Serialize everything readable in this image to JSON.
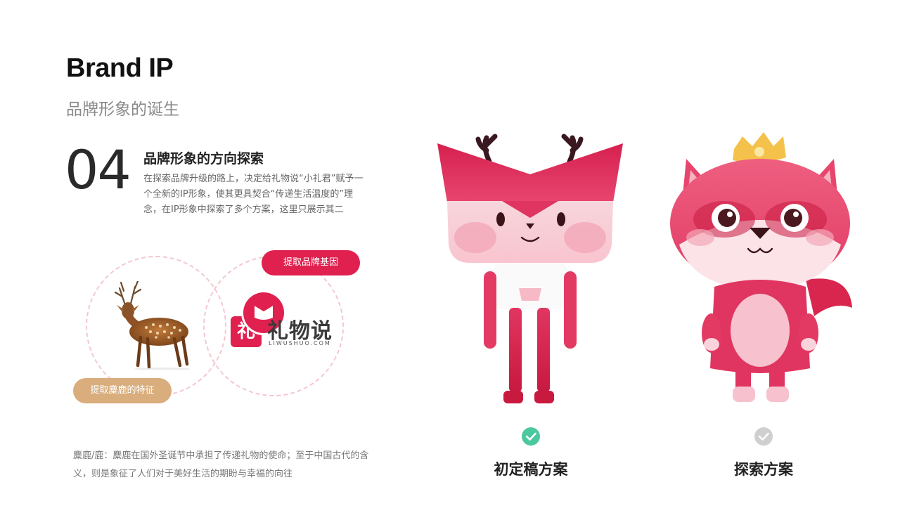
{
  "header": {
    "title": "Brand IP",
    "subtitle": "品牌形象的诞生"
  },
  "section": {
    "number": "04",
    "title": "品牌形象的方向探索",
    "description": "在探索品牌升级的路上，决定给礼物说“小礼君”赋予一个全新的IP形象，使其更具契合“传递生活温度的”理念，在IP形象中探索了多个方案，这里只展示其二"
  },
  "diagram": {
    "extract_brand_gene_label": "提取品牌基因",
    "extract_deer_feature_label": "提取麋鹿的特征",
    "logo_text": "礼物说",
    "logo_char": "礼",
    "logo_url": "LIWUSHUO.COM"
  },
  "deer_note": "麋鹿/鹿：麋鹿在国外圣诞节中承担了传递礼物的使命；至于中国古代的含义，则是象征了人们对于美好生活的期盼与幸福的向往",
  "options": [
    {
      "caption": "初定稿方案",
      "status": "selected",
      "check_color": "#4cc8a0"
    },
    {
      "caption": "探索方案",
      "status": "unselected",
      "check_color": "#cfcfcf"
    }
  ],
  "colors": {
    "brand_red": "#e0204f",
    "tan": "#d9ad7c"
  }
}
